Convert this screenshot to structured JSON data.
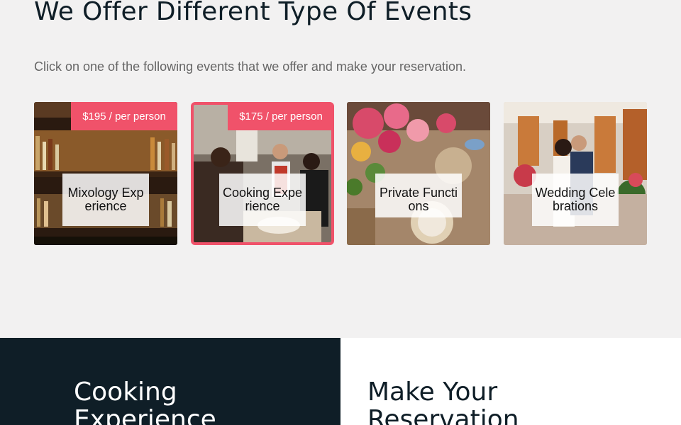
{
  "events_section": {
    "title": "We Offer Different Type Of Events",
    "subtitle": "Click on one of the following events that we offer and make your reservation."
  },
  "events": [
    {
      "label": "Mixology Experience",
      "price": "$195 / per person",
      "selected": false
    },
    {
      "label": "Cooking Experience",
      "price": "$175 / per person",
      "selected": true
    },
    {
      "label": "Private Functions",
      "price": "",
      "selected": false
    },
    {
      "label": "Wedding Celebrations",
      "price": "",
      "selected": false
    }
  ],
  "colors": {
    "accent": "#f0526a",
    "dark_navy": "#0f1e27",
    "page_background": "#f2f1f1"
  },
  "details_panel": {
    "title": "Cooking Experience"
  },
  "reservation_panel": {
    "title": "Make Your Reservation"
  }
}
